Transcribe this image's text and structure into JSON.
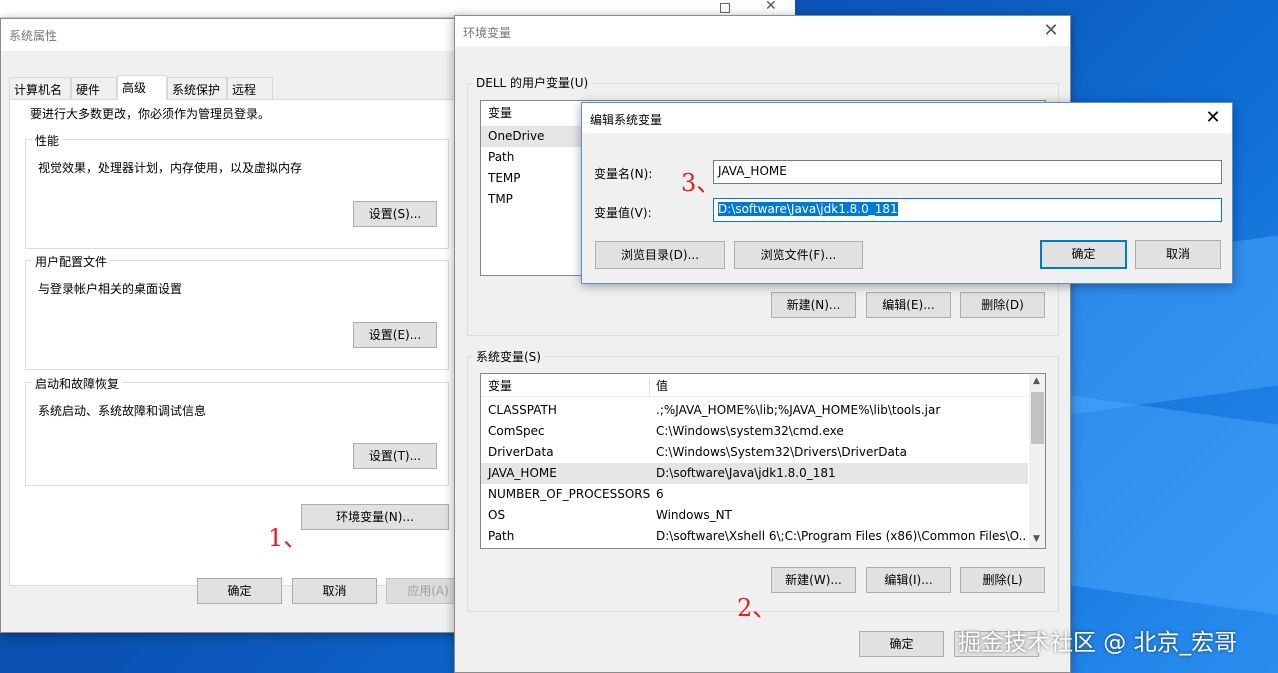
{
  "sys_props": {
    "title": "系统属性",
    "tabs": [
      "计算机名",
      "硬件",
      "高级",
      "系统保护",
      "远程"
    ],
    "admin_note": "要进行大多数更改，你必须作为管理员登录。",
    "performance": {
      "label": "性能",
      "desc": "视觉效果，处理器计划，内存使用，以及虚拟内存",
      "button": "设置(S)..."
    },
    "user_profile": {
      "label": "用户配置文件",
      "desc": "与登录帐户相关的桌面设置",
      "button": "设置(E)..."
    },
    "startup": {
      "label": "启动和故障恢复",
      "desc": "系统启动、系统故障和调试信息",
      "button": "设置(T)..."
    },
    "env_button": "环境变量(N)...",
    "ok": "确定",
    "cancel": "取消",
    "apply": "应用(A)"
  },
  "env_vars": {
    "title": "环境变量",
    "user_group": "DELL 的用户变量(U)",
    "user_header": "变量",
    "user_rows": [
      "OneDrive",
      "Path",
      "TEMP",
      "TMP"
    ],
    "user_buttons": {
      "new": "新建(N)...",
      "edit": "编辑(E)...",
      "delete": "删除(D)"
    },
    "sys_group": "系统变量(S)",
    "sys_header": {
      "name": "变量",
      "value": "值"
    },
    "sys_rows": [
      {
        "name": "CLASSPATH",
        "value": ".;%JAVA_HOME%\\lib;%JAVA_HOME%\\lib\\tools.jar"
      },
      {
        "name": "ComSpec",
        "value": "C:\\Windows\\system32\\cmd.exe"
      },
      {
        "name": "DriverData",
        "value": "C:\\Windows\\System32\\Drivers\\DriverData"
      },
      {
        "name": "JAVA_HOME",
        "value": "D:\\software\\Java\\jdk1.8.0_181"
      },
      {
        "name": "NUMBER_OF_PROCESSORS",
        "value": "6"
      },
      {
        "name": "OS",
        "value": "Windows_NT"
      },
      {
        "name": "Path",
        "value": "D:\\software\\Xshell 6\\;C:\\Program Files (x86)\\Common Files\\O..."
      }
    ],
    "sys_buttons": {
      "new": "新建(W)...",
      "edit": "编辑(I)...",
      "delete": "删除(L)"
    },
    "ok": "确定"
  },
  "edit_dialog": {
    "title": "编辑系统变量",
    "name_label": "变量名(N):",
    "name_value": "JAVA_HOME",
    "value_label": "变量值(V):",
    "value_value": "D:\\software\\Java\\jdk1.8.0_181",
    "browse_dir": "浏览目录(D)...",
    "browse_file": "浏览文件(F)...",
    "ok": "确定",
    "cancel": "取消"
  },
  "annotations": {
    "step1": "1、",
    "step2": "2、",
    "step3": "3、"
  },
  "watermark": "掘金技术社区 @ 北京_宏哥",
  "icons": [
    "close-icon",
    "maximize-icon",
    "scroll-up-icon",
    "scroll-down-icon"
  ],
  "colors": {
    "accent": "#0078d7",
    "annotation": "#e02020",
    "desktop": "#0b52b5"
  }
}
